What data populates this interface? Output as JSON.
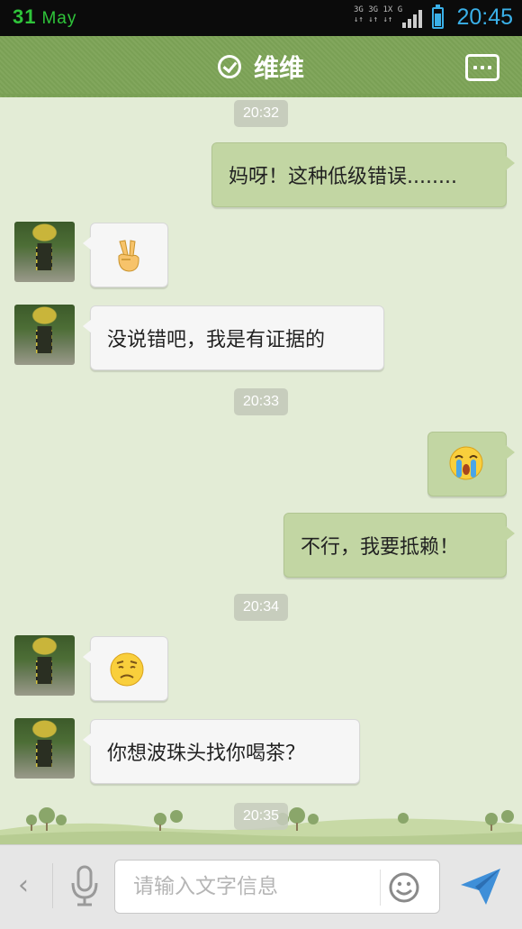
{
  "status_bar": {
    "date_day": "31",
    "date_month": "May",
    "network_top": "3G 3G 1X G",
    "network_bottom": "↓↑ ↓↑ ↓↑",
    "time": "20:45"
  },
  "header": {
    "title": "维维",
    "menu_icon": "more-menu-icon",
    "status_icon": "check-circle-icon"
  },
  "colors": {
    "header_bg": "#7aa055",
    "chat_bg": "#e3ecd6",
    "outgoing_bubble": "#c2d6a3",
    "incoming_bubble": "#f6f6f6",
    "time_accent": "#3ab0e8"
  },
  "messages": [
    {
      "type": "timestamp",
      "text": "20:32"
    },
    {
      "type": "outgoing",
      "text": "妈呀！这种低级错误........"
    },
    {
      "type": "incoming",
      "emoji": "peace-hand-emoji"
    },
    {
      "type": "incoming",
      "text": "没说错吧，我是有证据的"
    },
    {
      "type": "timestamp",
      "text": "20:33"
    },
    {
      "type": "outgoing",
      "emoji": "crying-face-emoji"
    },
    {
      "type": "outgoing",
      "text": "不行，我要抵赖！"
    },
    {
      "type": "timestamp",
      "text": "20:34"
    },
    {
      "type": "incoming",
      "emoji": "sad-face-emoji"
    },
    {
      "type": "incoming",
      "text": "你想波珠头找你喝茶？"
    },
    {
      "type": "timestamp",
      "text": "20:35"
    }
  ],
  "input_bar": {
    "placeholder": "请输入文字信息",
    "value": "",
    "back_icon": "chevron-left-icon",
    "voice_icon": "microphone-icon",
    "emoji_icon": "smiley-icon",
    "send_icon": "send-icon"
  }
}
